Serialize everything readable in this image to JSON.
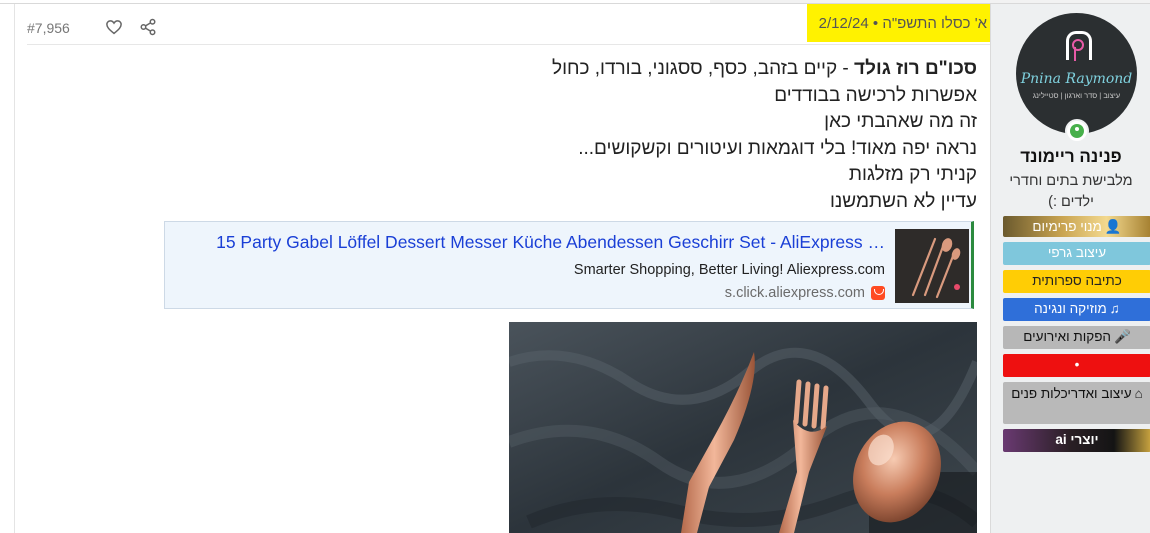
{
  "post": {
    "index": "#7,956",
    "date": {
      "hebrew": "א' כסלו התשפ\"ה",
      "separator": "•",
      "gregorian": "2/12/24"
    },
    "lines": {
      "l1_bold": "סכו\"ם רוז גולד",
      "l1_rest": " - קיים בזהב, כסף, ססגוני, בורדו, כחול",
      "l2": "אפשרות לרכישה בבודדים",
      "l3": "זה מה שאהבתי כאן",
      "l4": "נראה יפה מאוד! בלי דוגמאות ועיטורים וקשקושים...",
      "l5": "קניתי רק מזלגות",
      "l6": "עדיין לא השתמשנו"
    },
    "link_preview": {
      "title": "15 Party Gabel Löffel Dessert Messer Küche Abendessen Geschirr Set - AliExpress …",
      "description": "Smarter Shopping, Better Living! Aliexpress.com",
      "domain": "s.click.aliexpress.com",
      "site_icon": "aliexpress-icon"
    },
    "photo": {
      "subject": "rose-gold-cutlery-photo"
    },
    "icons": {
      "like": "heart-icon",
      "share": "share-icon"
    }
  },
  "user": {
    "avatar": {
      "logo_name": "Pnina Raymond",
      "logo_sub": "עיצוב | סדר וארגון | סטיילינג"
    },
    "status": "online",
    "name": "פנינה ריימונד",
    "title": "מלבישת בתים וחדרי ילדים :)",
    "badges": [
      {
        "label": "מנוי פרימיום",
        "icon": "user-icon"
      },
      {
        "label": "עיצוב גרפי"
      },
      {
        "label": "כתיבה ספרותית"
      },
      {
        "label": "מוזיקה ונגינה",
        "icon": "music-icon"
      },
      {
        "label": "הפקות ואירועים",
        "icon": "microphone-icon"
      },
      {
        "label": "•"
      },
      {
        "label": "עיצוב ואדריכלות פנים",
        "icon": "home-icon"
      },
      {
        "label": "יוצרי ai"
      }
    ]
  },
  "colors": {
    "highlight": "#fff200",
    "link": "#1a3fd6",
    "card_bg": "#eef5fc",
    "online": "#47b04b"
  }
}
